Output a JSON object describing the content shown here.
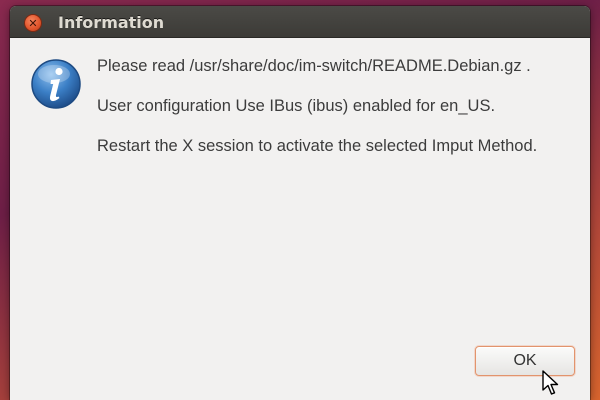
{
  "window": {
    "title": "Information",
    "close_icon": "close-icon"
  },
  "dialog": {
    "icon": "info-icon",
    "messages": [
      "Please read /usr/share/doc/im-switch/README.Debian.gz .",
      "User configuration Use IBus (ibus) enabled for en_US.",
      "Restart the X session to activate the selected Imput Method."
    ],
    "ok_label": "OK"
  },
  "colors": {
    "titlebar": "#3c3b37",
    "title_text": "#dfdbd2",
    "close_button": "#e2572e",
    "dialog_bg": "#f2f1f0",
    "info_icon": "#3b7fc6",
    "ok_focus_border": "#e2946d"
  }
}
